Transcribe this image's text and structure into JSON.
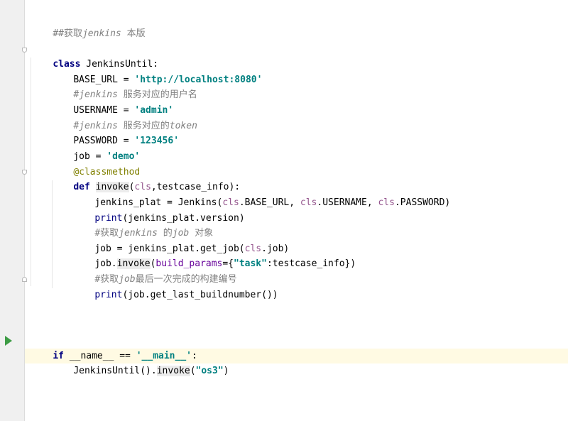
{
  "code": {
    "comment_header": {
      "hash": "##获取",
      "latin": "jenkins",
      "cn": " 本版"
    },
    "class_kw": "class",
    "class_name": " JenkinsUntil:",
    "base_url": {
      "lhs": "BASE_URL = ",
      "value": "'http://localhost:8080'"
    },
    "comment_user": {
      "hash": "#",
      "latin": "jenkins",
      "cn": " 服务对应的用户名"
    },
    "username": {
      "lhs": "USERNAME = ",
      "value": "'admin'"
    },
    "comment_token": {
      "hash": "#",
      "latin": "jenkins",
      "cn": " 服务对应的",
      "latin2": "token"
    },
    "password": {
      "lhs": "PASSWORD = ",
      "value": "'123456'"
    },
    "job": {
      "lhs": "job = ",
      "value": "'demo'"
    },
    "decorator": "@classmethod",
    "def_line": {
      "kw": "def",
      "name": "invoke",
      "open": "(",
      "cls": "cls",
      "rest": ",testcase_info):"
    },
    "plat_line": {
      "lhs": "jenkins_plat = Jenkins(",
      "cls1": "cls",
      "arg1": ".BASE_URL, ",
      "cls2": "cls",
      "arg2": ".USERNAME, ",
      "cls3": "cls",
      "arg3": ".PASSWORD)"
    },
    "print_version": {
      "fn": "print",
      "rest": "(jenkins_plat.version)"
    },
    "comment_job": {
      "hash": "#获取",
      "latin": "jenkins",
      "cn": " 的",
      "latin2": "job",
      "cn2": " 对象"
    },
    "get_job": {
      "lhs": "job = jenkins_plat.get_job(",
      "cls": "cls",
      "rest": ".job)"
    },
    "invoke_job": {
      "pre": "job.",
      "fn": "invoke",
      "open": "(",
      "kw": "build_params",
      "mid": "={",
      "key": "\"task\"",
      "rest": ":testcase_info})"
    },
    "comment_build": {
      "hash": "#获取",
      "latin": "job",
      "cn": "最后一次完成的构建编号"
    },
    "print_build": {
      "fn": "print",
      "rest": "(job.get_last_buildnumber())"
    },
    "if_main": {
      "kw": "if",
      "mid": " __name__ == ",
      "value": "'__main__'",
      "colon": ":"
    },
    "call_main": {
      "pre": "JenkinsUntil().",
      "fn": "invoke",
      "open": "(",
      "value": "\"os3\"",
      "close": ")"
    }
  },
  "colors": {
    "keyword": "#000080",
    "string": "#008080",
    "comment": "#808080",
    "self": "#94558d",
    "decorator": "#808000",
    "kwarg": "#660099",
    "current_line": "#fffae3",
    "run_icon": "#3d9c45"
  },
  "icons": {
    "run": "run-triangle-icon",
    "fold": "fold-marker-icon"
  }
}
